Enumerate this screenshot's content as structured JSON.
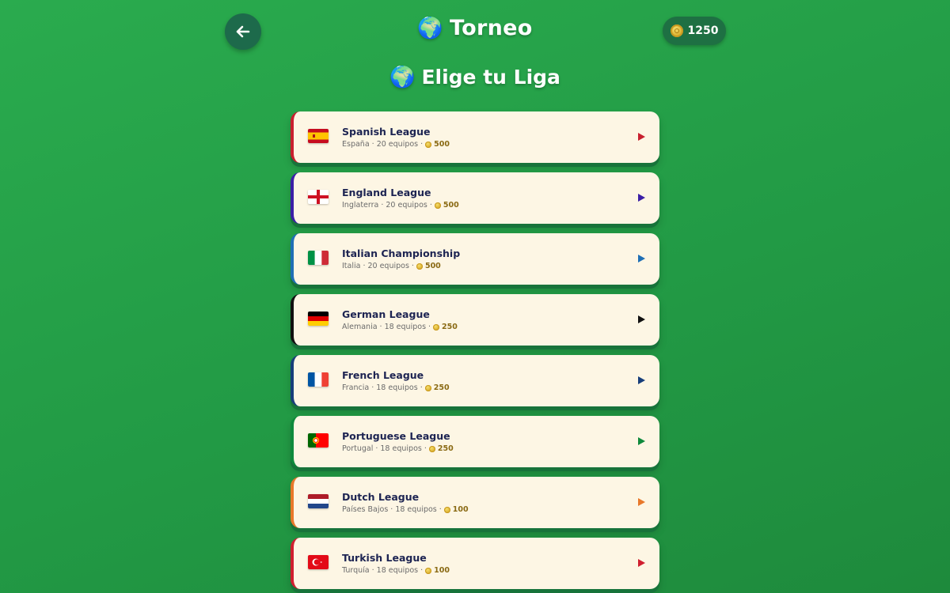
{
  "header": {
    "title": "Torneo",
    "coins": "1250",
    "back_icon": "arrow-left-icon",
    "title_icon": "globe-icon"
  },
  "section": {
    "title": "Elige tu Liga",
    "icon": "globe-icon"
  },
  "leagues": [
    {
      "name": "Spanish League",
      "country": "España",
      "teams": "20 equipos",
      "price": "500",
      "accent": "#c8202f",
      "flag": "spain"
    },
    {
      "name": "England League",
      "country": "Inglaterra",
      "teams": "20 equipos",
      "price": "500",
      "accent": "#3b1fa6",
      "flag": "england"
    },
    {
      "name": "Italian Championship",
      "country": "Italia",
      "teams": "20 equipos",
      "price": "500",
      "accent": "#1f6fb5",
      "flag": "italy"
    },
    {
      "name": "German League",
      "country": "Alemania",
      "teams": "18 equipos",
      "price": "250",
      "accent": "#111111",
      "flag": "germany"
    },
    {
      "name": "French League",
      "country": "Francia",
      "teams": "18 equipos",
      "price": "250",
      "accent": "#173e7a",
      "flag": "france"
    },
    {
      "name": "Portuguese League",
      "country": "Portugal",
      "teams": "18 equipos",
      "price": "250",
      "accent": "#0f8a3c",
      "flag": "portugal"
    },
    {
      "name": "Dutch League",
      "country": "Países Bajos",
      "teams": "18 equipos",
      "price": "100",
      "accent": "#e8782a",
      "flag": "netherlands"
    },
    {
      "name": "Turkish League",
      "country": "Turquía",
      "teams": "18 equipos",
      "price": "100",
      "accent": "#d01f2f",
      "flag": "turkey"
    }
  ]
}
